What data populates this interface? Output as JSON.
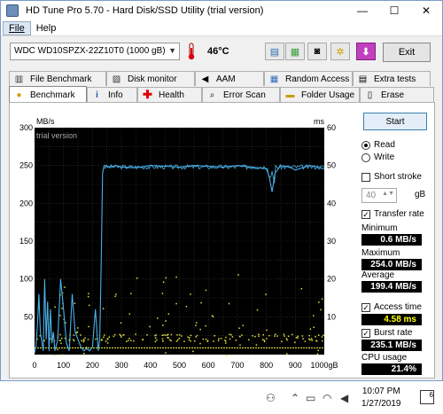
{
  "window": {
    "title": "HD Tune Pro 5.70 - Hard Disk/SSD Utility (trial version)",
    "minimize": "—",
    "maximize": "☐",
    "close": "✕"
  },
  "menu": {
    "file": "File",
    "help": "Help"
  },
  "toolbar": {
    "drive": "WDC WD10SPZX-22Z10T0 (1000 gB)",
    "temperature": "46°C",
    "exit": "Exit"
  },
  "tabs": {
    "row1": [
      "File Benchmark",
      "Disk monitor",
      "AAM",
      "Random Access",
      "Extra tests"
    ],
    "row2": [
      "Benchmark",
      "Info",
      "Health",
      "Error Scan",
      "Folder Usage",
      "Erase"
    ]
  },
  "side": {
    "start": "Start",
    "read": "Read",
    "write": "Write",
    "short_stroke": "Short stroke",
    "stroke_value": "40",
    "stroke_unit": "gB",
    "transfer_rate": "Transfer rate",
    "minimum_label": "Minimum",
    "minimum_value": "0.6 MB/s",
    "maximum_label": "Maximum",
    "maximum_value": "254.0 MB/s",
    "average_label": "Average",
    "average_value": "199.4 MB/s",
    "access_time": "Access time",
    "access_value": "4.58 ms",
    "burst_rate": "Burst rate",
    "burst_value": "235.1 MB/s",
    "cpu_label": "CPU usage",
    "cpu_value": "21.4%"
  },
  "chart_data": {
    "type": "line",
    "title": "",
    "watermark": "trial version",
    "y_left_unit": "MB/s",
    "y_right_unit": "ms",
    "y_left_ticks": [
      "300",
      "250",
      "200",
      "150",
      "100",
      "50"
    ],
    "y_right_ticks": [
      "60",
      "50",
      "40",
      "30",
      "20",
      "10"
    ],
    "x_ticks": [
      "0",
      "100",
      "200",
      "300",
      "400",
      "500",
      "600",
      "700",
      "800",
      "900",
      "1000gB"
    ],
    "xlim": [
      0,
      1000
    ],
    "ylim_left": [
      0,
      300
    ],
    "ylim_right": [
      0,
      60
    ],
    "grid": true,
    "series": [
      {
        "x": [
          0,
          5,
          10,
          15,
          20,
          30,
          35,
          40,
          45,
          50,
          55,
          60,
          65,
          70,
          80,
          90,
          100,
          110,
          120,
          130,
          140,
          150,
          160,
          170,
          180,
          190,
          200,
          210,
          220,
          225,
          230,
          235,
          240,
          250,
          260,
          280,
          300,
          350,
          400,
          450,
          500,
          550,
          600,
          650,
          700,
          750,
          800,
          810,
          820,
          830,
          850,
          880,
          900,
          950,
          980,
          1000
        ],
        "y": [
          2,
          10,
          40,
          80,
          30,
          5,
          100,
          20,
          70,
          5,
          60,
          15,
          30,
          5,
          20,
          100,
          60,
          15,
          5,
          80,
          30,
          20,
          10,
          5,
          8,
          5,
          10,
          60,
          5,
          20,
          120,
          240,
          250,
          249,
          248,
          250,
          248,
          247,
          250,
          249,
          248,
          250,
          249,
          248,
          250,
          248,
          246,
          235,
          215,
          240,
          250,
          248,
          244,
          250,
          248,
          245
        ],
        "color": "#4ab0e8"
      }
    ],
    "scatter_color": "#e0e040",
    "access_time_ms": 4.58
  },
  "taskbar": {
    "time": "10:07 PM",
    "date": "1/27/2019",
    "notifications": "6"
  }
}
